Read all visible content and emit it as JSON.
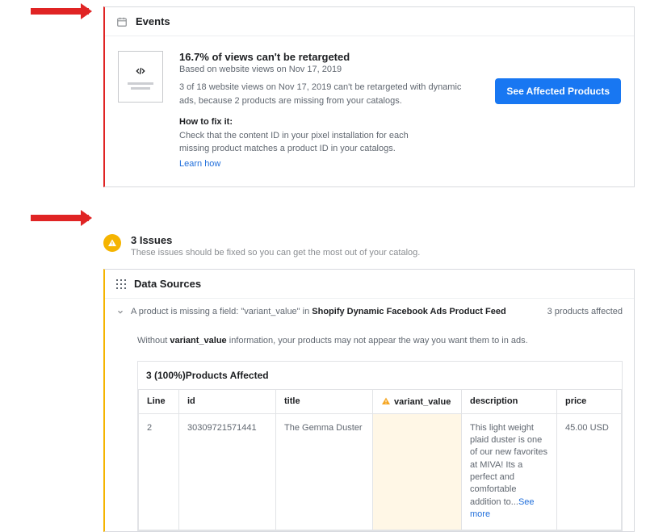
{
  "colors": {
    "error_accent": "#e02424",
    "warning_accent": "#f5b400",
    "primary_button": "#1877f2",
    "link": "#216fdb"
  },
  "events": {
    "section_title": "Events",
    "headline": "16.7% of views can't be retargeted",
    "based_on": "Based on website views on Nov 17, 2019",
    "description": "3 of 18 website views on Nov 17, 2019 can't be retargeted with dynamic ads, because 2 products are missing from your catalogs.",
    "fix_label": "How to fix it:",
    "fix_text": "Check that the content ID in your pixel installation for each missing product matches a product ID in your catalogs.",
    "learn_how": "Learn how",
    "cta": "See Affected Products"
  },
  "issues": {
    "title": "3 Issues",
    "subtitle": "These issues should be fixed so you can get the most out of your catalog.",
    "data_sources_label": "Data Sources",
    "row_prefix": "A product is missing a field: \"variant_value\" in ",
    "row_feed": "Shopify Dynamic Facebook Ads Product Feed",
    "affected_count": "3 products affected",
    "detail_prefix": "Without ",
    "detail_field": "variant_value",
    "detail_suffix": " information, your products may not appear the way you want them to in ads.",
    "affected_title": "3 (100%)Products Affected",
    "columns": {
      "line": "Line",
      "id": "id",
      "title": "title",
      "variant_value": "variant_value",
      "description": "description",
      "price": "price"
    },
    "rows": [
      {
        "line": "2",
        "id": "30309721571441",
        "title": "The Gemma Duster",
        "variant_value": "",
        "description": "This light weight plaid duster is one of our new favorites at MIVA! Its a perfect and comfortable addition to...",
        "see_more": "See more",
        "price": "45.00 USD"
      }
    ]
  }
}
